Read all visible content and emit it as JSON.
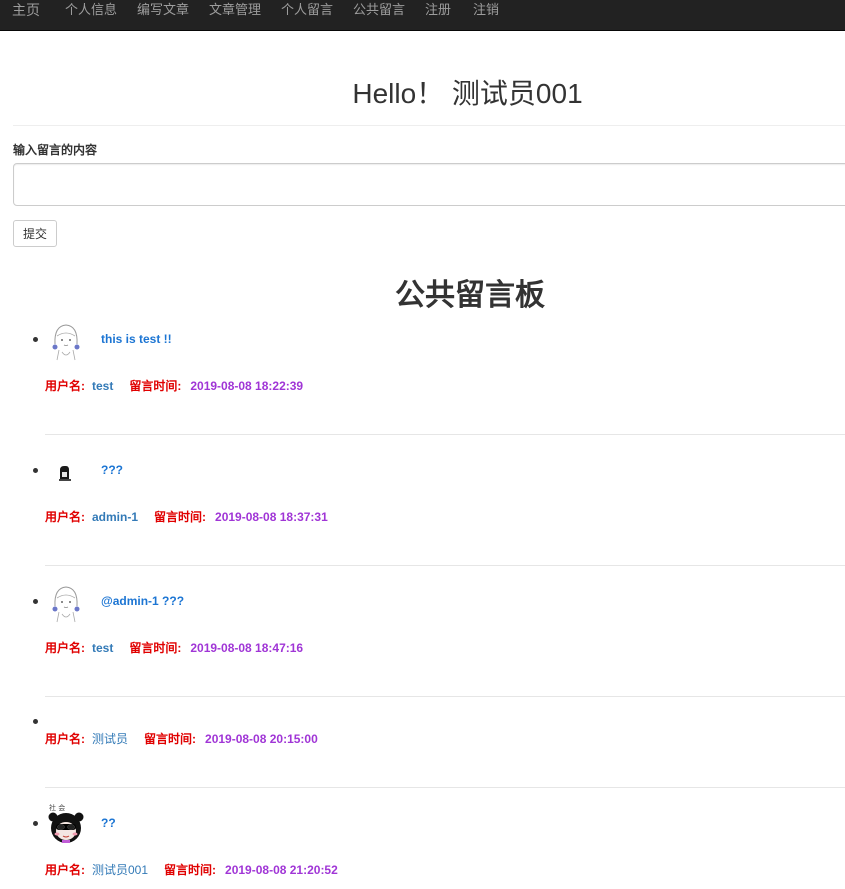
{
  "nav": {
    "brand": "主页",
    "items": [
      "个人信息",
      "编写文章",
      "文章管理",
      "个人留言",
      "公共留言",
      "注册",
      "注销"
    ]
  },
  "greeting": "Hello！ 测试员001",
  "form": {
    "label": "输入留言的内容",
    "input_value": "",
    "submit_label": "提交"
  },
  "board_title": "公共留言板",
  "labels": {
    "username": "用户名:",
    "time": "留言时间:"
  },
  "messages": [
    {
      "avatar": "girl-sketch-avatar",
      "content": "this is test !!",
      "username": "test",
      "time": "2019-08-08 18:22:39"
    },
    {
      "avatar": "small-figure-avatar",
      "content": "???",
      "username": "admin-1",
      "time": "2019-08-08 18:37:31"
    },
    {
      "avatar": "girl-sketch-avatar",
      "content": "@admin-1 ???",
      "username": "test",
      "time": "2019-08-08 18:47:16"
    },
    {
      "avatar": "",
      "content": "",
      "username": "测试员",
      "time": "2019-08-08 20:15:00"
    },
    {
      "avatar": "panda-girl-avatar",
      "content": "??",
      "username": "测试员001",
      "time": "2019-08-08 21:20:52"
    }
  ],
  "colors": {
    "navbar": "#222222",
    "nav_text": "#9d9d9d",
    "content_blue": "#1c75d3",
    "label_red": "#e00000",
    "user_blue": "#337ab7",
    "time_purple": "#a035d6"
  }
}
